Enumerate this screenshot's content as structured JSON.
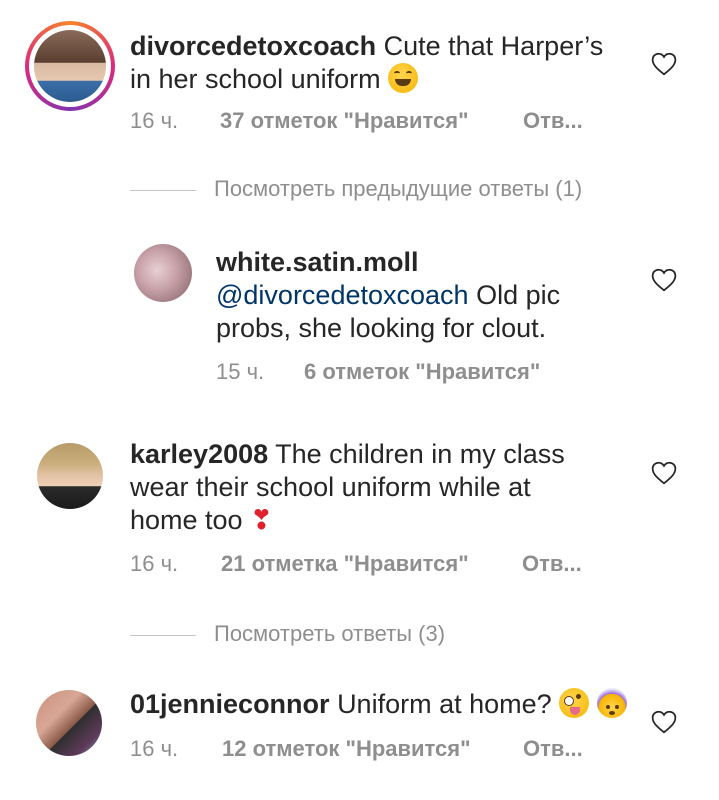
{
  "comments": [
    {
      "username": "divorcedetoxcoach",
      "text": "Cute that Harper's in her school uniform",
      "line1": "Cute that Harper’s",
      "line2": "in her school uniform",
      "emoji": "😂",
      "time": "16 ч.",
      "likes": "37 отметок \"Нравится\"",
      "reply": "Отв..."
    },
    {
      "username": "white.satin.moll",
      "mention": "@divorcedetoxcoach",
      "line1": "Old pic",
      "line2": "probs, she looking for clout.",
      "time": "15 ч.",
      "likes": "6 отметок \"Нравится\""
    },
    {
      "username": "karley2008",
      "line1": "The children in my class",
      "line2": "wear their school uniform while at",
      "line3": "home too",
      "emoji": "❣️",
      "time": "16 ч.",
      "likes": "21 отметка \"Нравится\"",
      "reply": "Отв..."
    },
    {
      "username": "01jennieconnor",
      "line1": "Uniform at home?",
      "emoji1": "🤪",
      "emoji2": "🤯",
      "time": "16 ч.",
      "likes": "12 отметок \"Нравится\"",
      "reply": "Отв..."
    }
  ],
  "view_previous": "Посмотреть предыдущие ответы (1)",
  "view_replies": "Посмотреть ответы (3)",
  "icons": {
    "like": "heart-outline-icon"
  },
  "colors": {
    "text": "#262626",
    "meta": "#8e8e8e",
    "mention": "#003569",
    "story_ring": "#e1306c"
  }
}
